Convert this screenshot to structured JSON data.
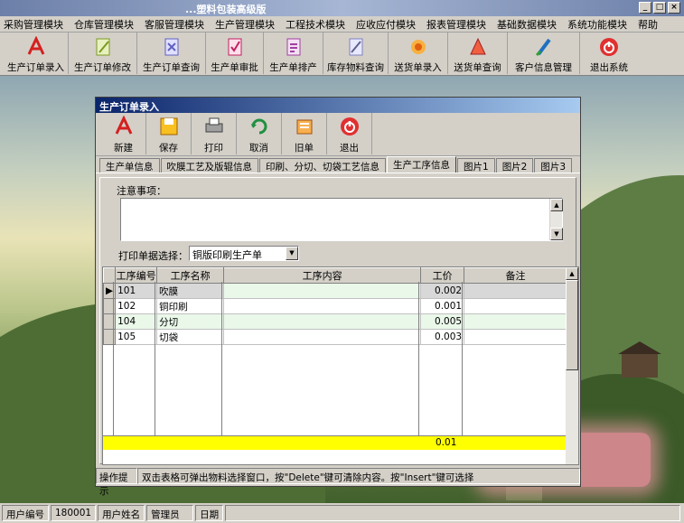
{
  "app": {
    "title": "...塑料包装高级版"
  },
  "menu": [
    "采购管理模块",
    "仓库管理模块",
    "客服管理模块",
    "生产管理模块",
    "工程技术模块",
    "应收应付模块",
    "报表管理模块",
    "基础数据模块",
    "系统功能模块",
    "帮助"
  ],
  "toolbar": [
    {
      "label": "生产订单录入",
      "icon": "pdf-icon",
      "color": "#d42020"
    },
    {
      "label": "生产订单修改",
      "icon": "edit-doc-icon",
      "color": "#7a9a20"
    },
    {
      "label": "生产订单查询",
      "icon": "query-doc-icon",
      "color": "#6060c0"
    },
    {
      "label": "生产单审批",
      "icon": "approve-icon",
      "color": "#c02060"
    },
    {
      "label": "生产单排产",
      "icon": "schedule-icon",
      "color": "#a040a0"
    },
    {
      "label": "库存物料查询",
      "icon": "stock-icon",
      "color": "#8080c0"
    },
    {
      "label": "送货单录入",
      "icon": "flower-icon",
      "color": "#f08020"
    },
    {
      "label": "送货单查询",
      "icon": "delivery-query-icon",
      "color": "#d03030"
    },
    {
      "label": "客户信息管理",
      "icon": "customer-icon",
      "color": "#2070c0"
    },
    {
      "label": "退出系统",
      "icon": "exit-icon",
      "color": "#e03030"
    }
  ],
  "form": {
    "title": "生产订单录入",
    "tools": [
      {
        "label": "新建",
        "icon": "new-icon",
        "color": "#d42020"
      },
      {
        "label": "保存",
        "icon": "save-icon",
        "color": "#f0a000"
      },
      {
        "label": "打印",
        "icon": "print-icon",
        "color": "#606060"
      },
      {
        "label": "取消",
        "icon": "cancel-icon",
        "color": "#209040"
      },
      {
        "label": "旧单",
        "icon": "old-order-icon",
        "color": "#e08020"
      },
      {
        "label": "退出",
        "icon": "exit-icon",
        "color": "#e03030"
      }
    ],
    "tabs": [
      "生产单信息",
      "吹膜工艺及版辊信息",
      "印刷、分切、切袋工艺信息",
      "生产工序信息",
      "图片1",
      "图片2",
      "图片3"
    ],
    "active_tab": "生产工序信息",
    "note_label": "注意事项：",
    "print_label": "打印单据选择：",
    "print_value": "铜版印刷生产单",
    "columns": [
      "工序编号",
      "工序名称",
      "工序内容",
      "工价",
      "备注"
    ],
    "rows": [
      {
        "code": "101",
        "name": "吹膜",
        "content": "",
        "price": "0.002",
        "remark": ""
      },
      {
        "code": "102",
        "name": "铜印刷",
        "content": "",
        "price": "0.001",
        "remark": ""
      },
      {
        "code": "104",
        "name": "分切",
        "content": "",
        "price": "0.005",
        "remark": ""
      },
      {
        "code": "105",
        "name": "切袋",
        "content": "",
        "price": "0.003",
        "remark": ""
      }
    ],
    "total_price": "0.01",
    "hint_label": "操作提示",
    "hint_text": "双击表格可弹出物料选择窗口，按\"Delete\"键可清除内容。按\"Insert\"键可选择"
  },
  "status": [
    {
      "label": "用户编号"
    },
    {
      "label": "180001"
    },
    {
      "label": "用户姓名"
    },
    {
      "label": "管理员"
    },
    {
      "label": "日期"
    }
  ]
}
